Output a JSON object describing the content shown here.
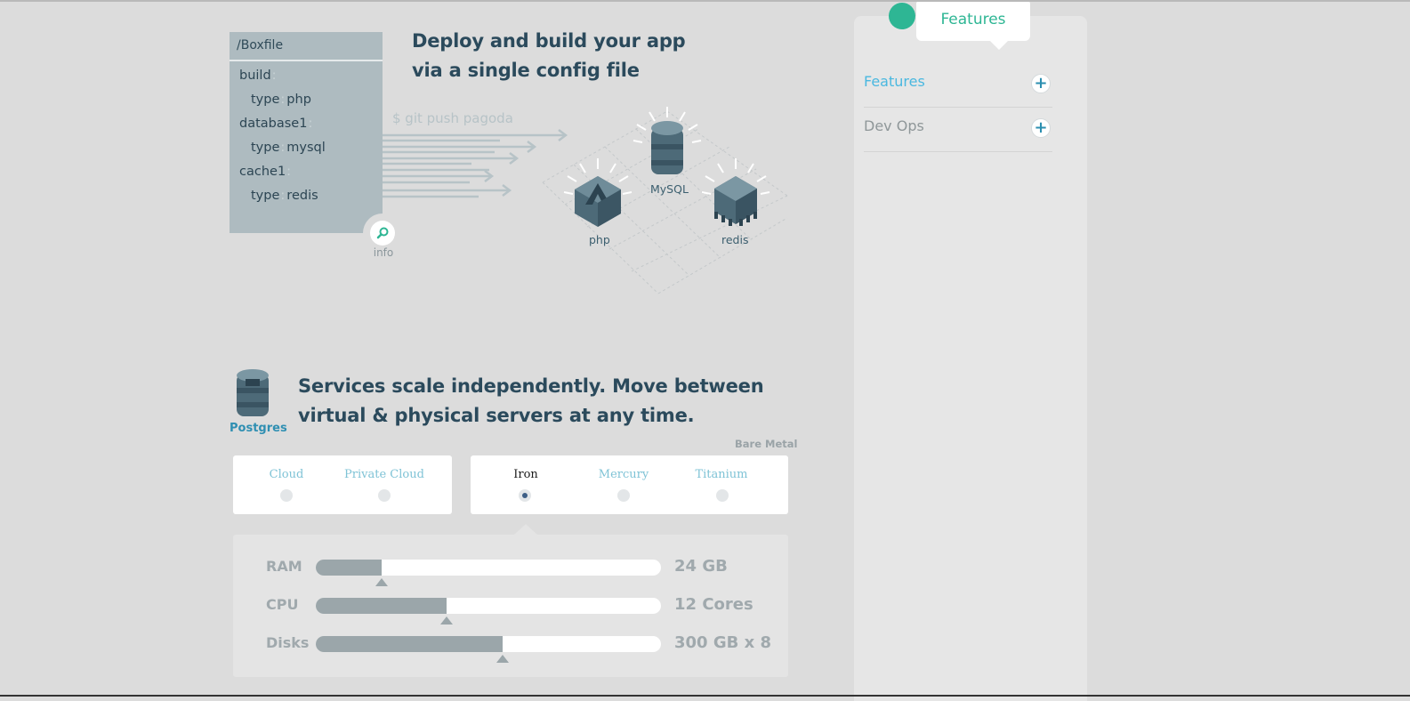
{
  "boxfile": {
    "title": "/Boxfile",
    "lines": [
      {
        "key": "build",
        "value": ""
      },
      {
        "key": "type",
        "value": "php"
      },
      {
        "key": "database1",
        "value": ""
      },
      {
        "key": "type",
        "value": "mysql"
      },
      {
        "key": "cache1",
        "value": ""
      },
      {
        "key": "type",
        "value": "redis"
      }
    ],
    "info_label": "info"
  },
  "deploy": {
    "headline_line1": "Deploy and build your app",
    "headline_line2": "via a single config file",
    "command": "$ git push pagoda",
    "services": [
      "php",
      "MySQL",
      "redis"
    ]
  },
  "scale": {
    "icon_label": "Postgres",
    "headline_line1": "Services scale independently. Move between",
    "headline_line2": "virtual & physical servers at any time.",
    "bare_metal_label": "Bare Metal",
    "virtual_options": [
      "Cloud",
      "Private Cloud"
    ],
    "metal_options": [
      "Iron",
      "Mercury",
      "Titanium"
    ],
    "selected_option": "Iron",
    "specs": [
      {
        "label": "RAM",
        "value": "24 GB",
        "level": 0.19
      },
      {
        "label": "CPU",
        "value": "12 Cores",
        "level": 0.38
      },
      {
        "label": "Disks",
        "value": "300 GB x 8",
        "level": 0.54
      }
    ]
  },
  "sidebar": {
    "tab_label": "Features",
    "items": [
      {
        "label": "Features",
        "active": true
      },
      {
        "label": "Dev Ops",
        "active": false
      }
    ],
    "colors": {
      "accent": "#2eb694",
      "active_link": "#4ab8e0",
      "inactive_link": "#8f9799"
    }
  }
}
